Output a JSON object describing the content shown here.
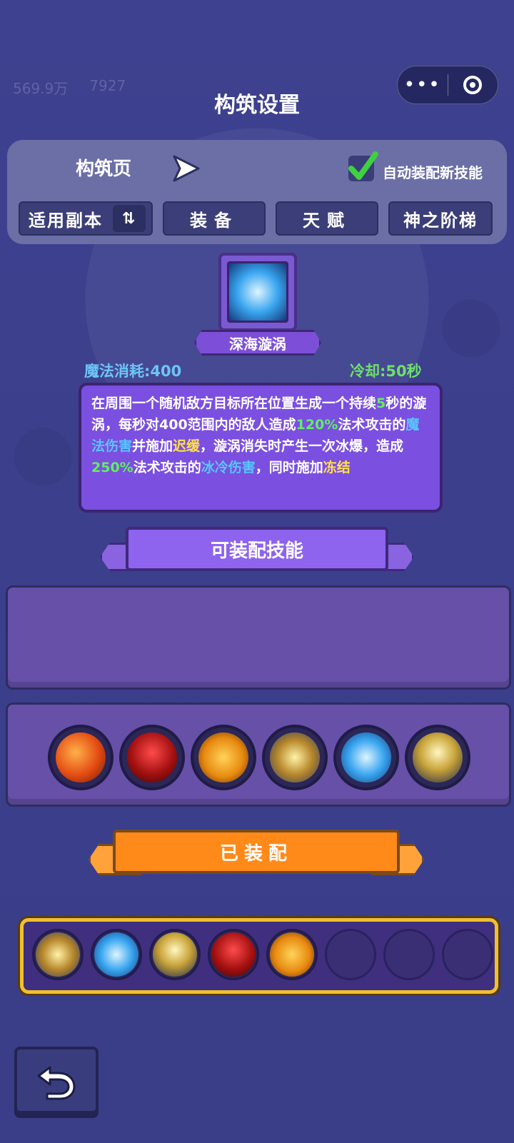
{
  "header": {
    "title": "构筑设置",
    "faded_resources": [
      "569.9万",
      "7927"
    ],
    "capsule": {
      "more": "•••"
    }
  },
  "build": {
    "page_label": "构筑页",
    "auto_equip_label": "自动装配新技能",
    "auto_equip_checked": true,
    "tabs": [
      "适用副本",
      "装备",
      "天赋",
      "神之阶梯"
    ]
  },
  "selected_skill": {
    "name": "深海漩涡",
    "mana": "魔法消耗:400",
    "cooldown": "冷却:50秒",
    "description_parts": [
      {
        "text": "在周围一个随机敌方目标所在位置生成一个持续",
        "color": "white"
      },
      {
        "text": "5",
        "color": "green"
      },
      {
        "text": "秒的漩涡，每秒对400范围内的敌人造成",
        "color": "white"
      },
      {
        "text": "120%",
        "color": "green"
      },
      {
        "text": "法术攻击的",
        "color": "white"
      },
      {
        "text": "魔法伤害",
        "color": "blue"
      },
      {
        "text": "并施加",
        "color": "white"
      },
      {
        "text": "迟缓",
        "color": "yellow"
      },
      {
        "text": "，漩涡消失时产生一次冰爆，造成",
        "color": "white"
      },
      {
        "text": "250%",
        "color": "green"
      },
      {
        "text": "法术攻击的",
        "color": "white"
      },
      {
        "text": "冰冷伤害",
        "color": "blue"
      },
      {
        "text": "，同时施加",
        "color": "white"
      },
      {
        "text": "冻结",
        "color": "yellow"
      }
    ]
  },
  "available": {
    "banner": "可装配技能",
    "skills": [
      "fire-orb-icon",
      "red-mage-icon",
      "gold-burst-icon",
      "storm-golem-icon",
      "ice-vortex-icon",
      "holy-staff-icon"
    ]
  },
  "equipped": {
    "banner": "已装配",
    "slots": [
      "storm-golem-icon",
      "ice-vortex-icon",
      "holy-staff-icon",
      "red-mage-icon",
      "gold-burst-icon",
      "",
      "",
      ""
    ]
  },
  "colors": {
    "background": "#3b3f8c",
    "accent_orange": "#ff8a1a",
    "accent_purple": "#8e63ee",
    "equipped_border": "#f0c030"
  }
}
